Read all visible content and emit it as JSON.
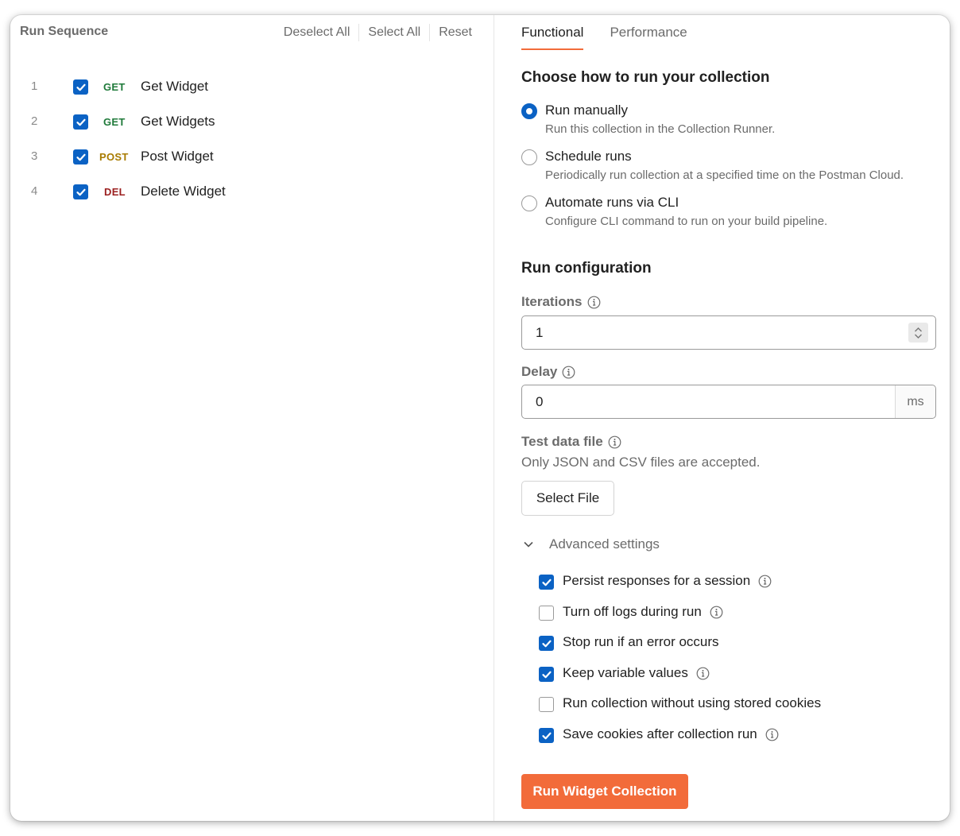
{
  "left": {
    "title": "Run Sequence",
    "actions": {
      "deselect_all": "Deselect All",
      "select_all": "Select All",
      "reset": "Reset"
    },
    "requests": [
      {
        "num": "1",
        "method": "GET",
        "name": "Get Widget",
        "checked": true
      },
      {
        "num": "2",
        "method": "GET",
        "name": "Get Widgets",
        "checked": true
      },
      {
        "num": "3",
        "method": "POST",
        "name": "Post Widget",
        "checked": true
      },
      {
        "num": "4",
        "method": "DEL",
        "name": "Delete Widget",
        "checked": true
      }
    ]
  },
  "tabs": {
    "functional": "Functional",
    "performance": "Performance",
    "active": "Functional"
  },
  "run_mode": {
    "heading": "Choose how to run your collection",
    "options": [
      {
        "label": "Run manually",
        "desc": "Run this collection in the Collection Runner.",
        "selected": true
      },
      {
        "label": "Schedule runs",
        "desc": "Periodically run collection at a specified time on the Postman Cloud.",
        "selected": false
      },
      {
        "label": "Automate runs via CLI",
        "desc": "Configure CLI command to run on your build pipeline.",
        "selected": false
      }
    ]
  },
  "config": {
    "heading": "Run configuration",
    "iterations": {
      "label": "Iterations",
      "value": "1"
    },
    "delay": {
      "label": "Delay",
      "value": "0",
      "unit": "ms"
    },
    "test_data": {
      "label": "Test data file",
      "hint": "Only JSON and CSV files are accepted.",
      "button": "Select File"
    }
  },
  "advanced": {
    "label": "Advanced settings",
    "expanded": true,
    "options": [
      {
        "label": "Persist responses for a session",
        "checked": true,
        "info": true
      },
      {
        "label": "Turn off logs during run",
        "checked": false,
        "info": true
      },
      {
        "label": "Stop run if an error occurs",
        "checked": true,
        "info": false
      },
      {
        "label": "Keep variable values",
        "checked": true,
        "info": true
      },
      {
        "label": "Run collection without using stored cookies",
        "checked": false,
        "info": false
      },
      {
        "label": "Save cookies after collection run",
        "checked": true,
        "info": true
      }
    ]
  },
  "run_button": "Run Widget Collection",
  "colors": {
    "accent": "#f26b3a",
    "checkbox": "#0b62c4",
    "get": "#1f7a3a",
    "post": "#a87b00",
    "del": "#9b1f1f"
  }
}
